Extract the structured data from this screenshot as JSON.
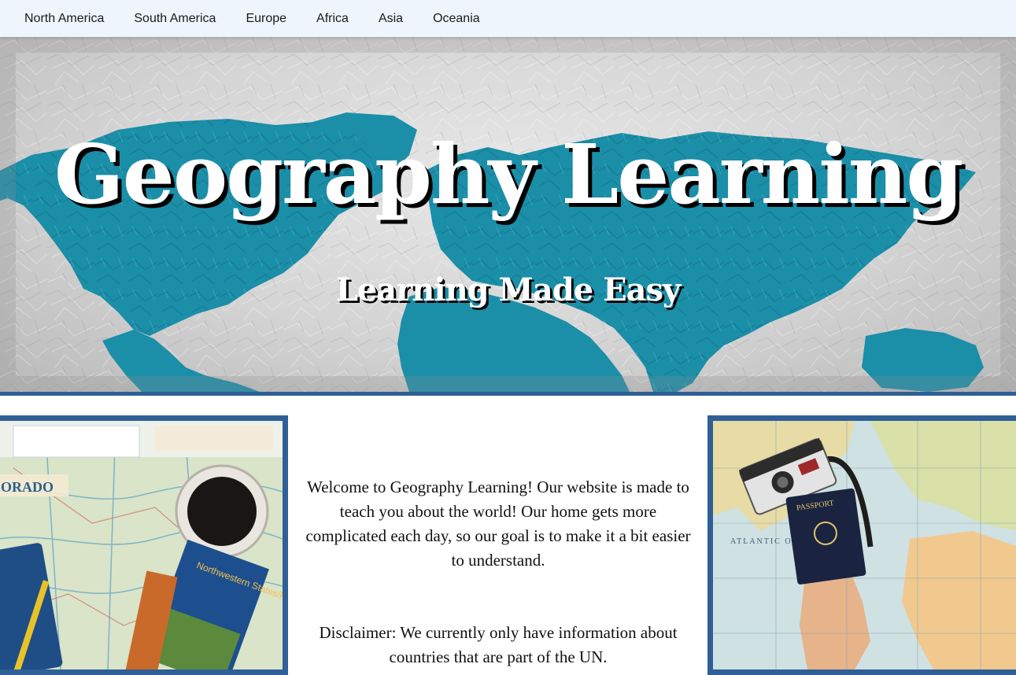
{
  "nav": {
    "items": [
      {
        "label": "North America"
      },
      {
        "label": "South America"
      },
      {
        "label": "Europe"
      },
      {
        "label": "Africa"
      },
      {
        "label": "Asia"
      },
      {
        "label": "Oceania"
      }
    ]
  },
  "hero": {
    "title": "Geography Learning",
    "subtitle": "Learning Made Easy",
    "map_color": "#1b8ea8",
    "bottom_rule_color": "#2f5f97"
  },
  "intro": {
    "welcome": "Welcome to Geography Learning! Our website is made to teach you about the world! Our home gets more complicated each day, so our goal is to make it a bit easier to understand.",
    "disclaimer": "Disclaimer: We currently only have information about countries that are part of the UN."
  },
  "photos": {
    "left": {
      "icon": "map-coffee-photo",
      "map_label": "ORADO",
      "brochure_text": "Northwestern States/Provinces"
    },
    "right": {
      "icon": "map-camera-passport-photo",
      "passport_label": "PASSPORT",
      "ocean_label": "ATLANTIC OCEAN"
    }
  }
}
